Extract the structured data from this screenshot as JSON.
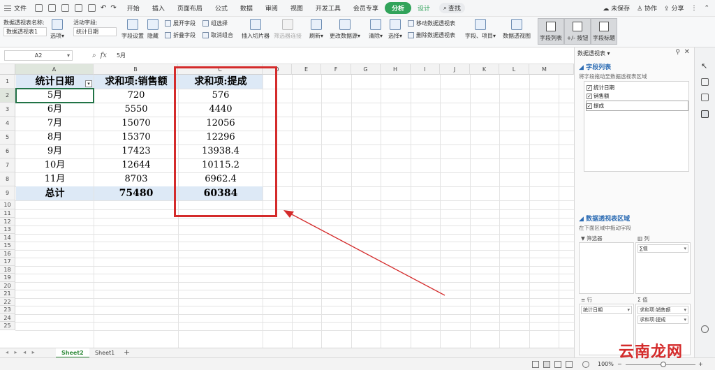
{
  "menubar": {
    "file": "文件",
    "tabs": [
      "开始",
      "插入",
      "页面布局",
      "公式",
      "数据",
      "审阅",
      "视图",
      "开发工具",
      "会员专享"
    ],
    "active_tab": "分析",
    "design_tab": "设计",
    "search": "查找",
    "unsaved": "未保存",
    "collab": "协作",
    "share": "分享"
  },
  "ribbon": {
    "pivot_name_label": "数据透视表名称:",
    "pivot_name_value": "数据透视表1",
    "options": "选项",
    "active_field_label": "活动字段:",
    "active_field_value": "统计日期",
    "field_settings": "字段设置",
    "hide": "隐藏",
    "expand_field": "展开字段",
    "collapse_field": "折叠字段",
    "group_select": "组选择",
    "ungroup": "取消组合",
    "insert_slicer": "插入切片器",
    "filter_conn": "筛选器连接",
    "refresh": "刷新",
    "change_source": "更改数据源",
    "clear": "清除",
    "select": "选择",
    "move_pivot": "移动数据透视表",
    "delete_pivot": "删除数据透视表",
    "fields_items": "字段、项目",
    "pivot_chart": "数据透视图",
    "field_list": "字段列表",
    "plus_minus": "+/- 按钮",
    "field_header": "字段标题"
  },
  "formula": {
    "cell_ref": "A2",
    "fx": "fx",
    "value": "5月"
  },
  "grid": {
    "columns": [
      "A",
      "B",
      "C",
      "D",
      "E",
      "F",
      "G",
      "H",
      "I",
      "J",
      "K",
      "L",
      "M"
    ],
    "rows": [
      "1",
      "2",
      "3",
      "4",
      "5",
      "6",
      "7",
      "8",
      "9",
      "10",
      "11",
      "12",
      "13",
      "14",
      "15",
      "16",
      "17",
      "18",
      "19",
      "20",
      "21",
      "22",
      "23",
      "24",
      "25"
    ],
    "header": [
      "统计日期",
      "求和项:销售额",
      "求和项:提成"
    ],
    "data": [
      [
        "5月",
        "720",
        "576"
      ],
      [
        "6月",
        "5550",
        "4440"
      ],
      [
        "7月",
        "15070",
        "12056"
      ],
      [
        "8月",
        "15370",
        "12296"
      ],
      [
        "9月",
        "17423",
        "13938.4"
      ],
      [
        "10月",
        "12644",
        "10115.2"
      ],
      [
        "11月",
        "8703",
        "6962.4"
      ]
    ],
    "total": [
      "总计",
      "75480",
      "60384"
    ]
  },
  "sheets": {
    "tabs": [
      "Sheet2",
      "Sheet1"
    ],
    "active": "Sheet2",
    "add": "+"
  },
  "status": {
    "zoom": "100%"
  },
  "pane": {
    "title": "数据透视表",
    "field_list_title": "字段列表",
    "field_list_hint": "将字段拖动至数据透视表区域",
    "fields": [
      "统计日期",
      "销售额",
      "提成"
    ],
    "areas_title": "数据透视表区域",
    "areas_hint": "在下面区域中拖动字段",
    "filter_label": "筛选器",
    "col_label": "列",
    "col_items": [
      "∑值"
    ],
    "row_label": "行",
    "row_items": [
      "统计日期"
    ],
    "value_label": "值",
    "value_items": [
      "求和项:销售额",
      "求和项:提成"
    ]
  },
  "watermark": "云南龙网",
  "colors": {
    "accent_green": "#31a35a",
    "header_fill": "#dde9f6",
    "highlight_red": "#d42b2b"
  }
}
